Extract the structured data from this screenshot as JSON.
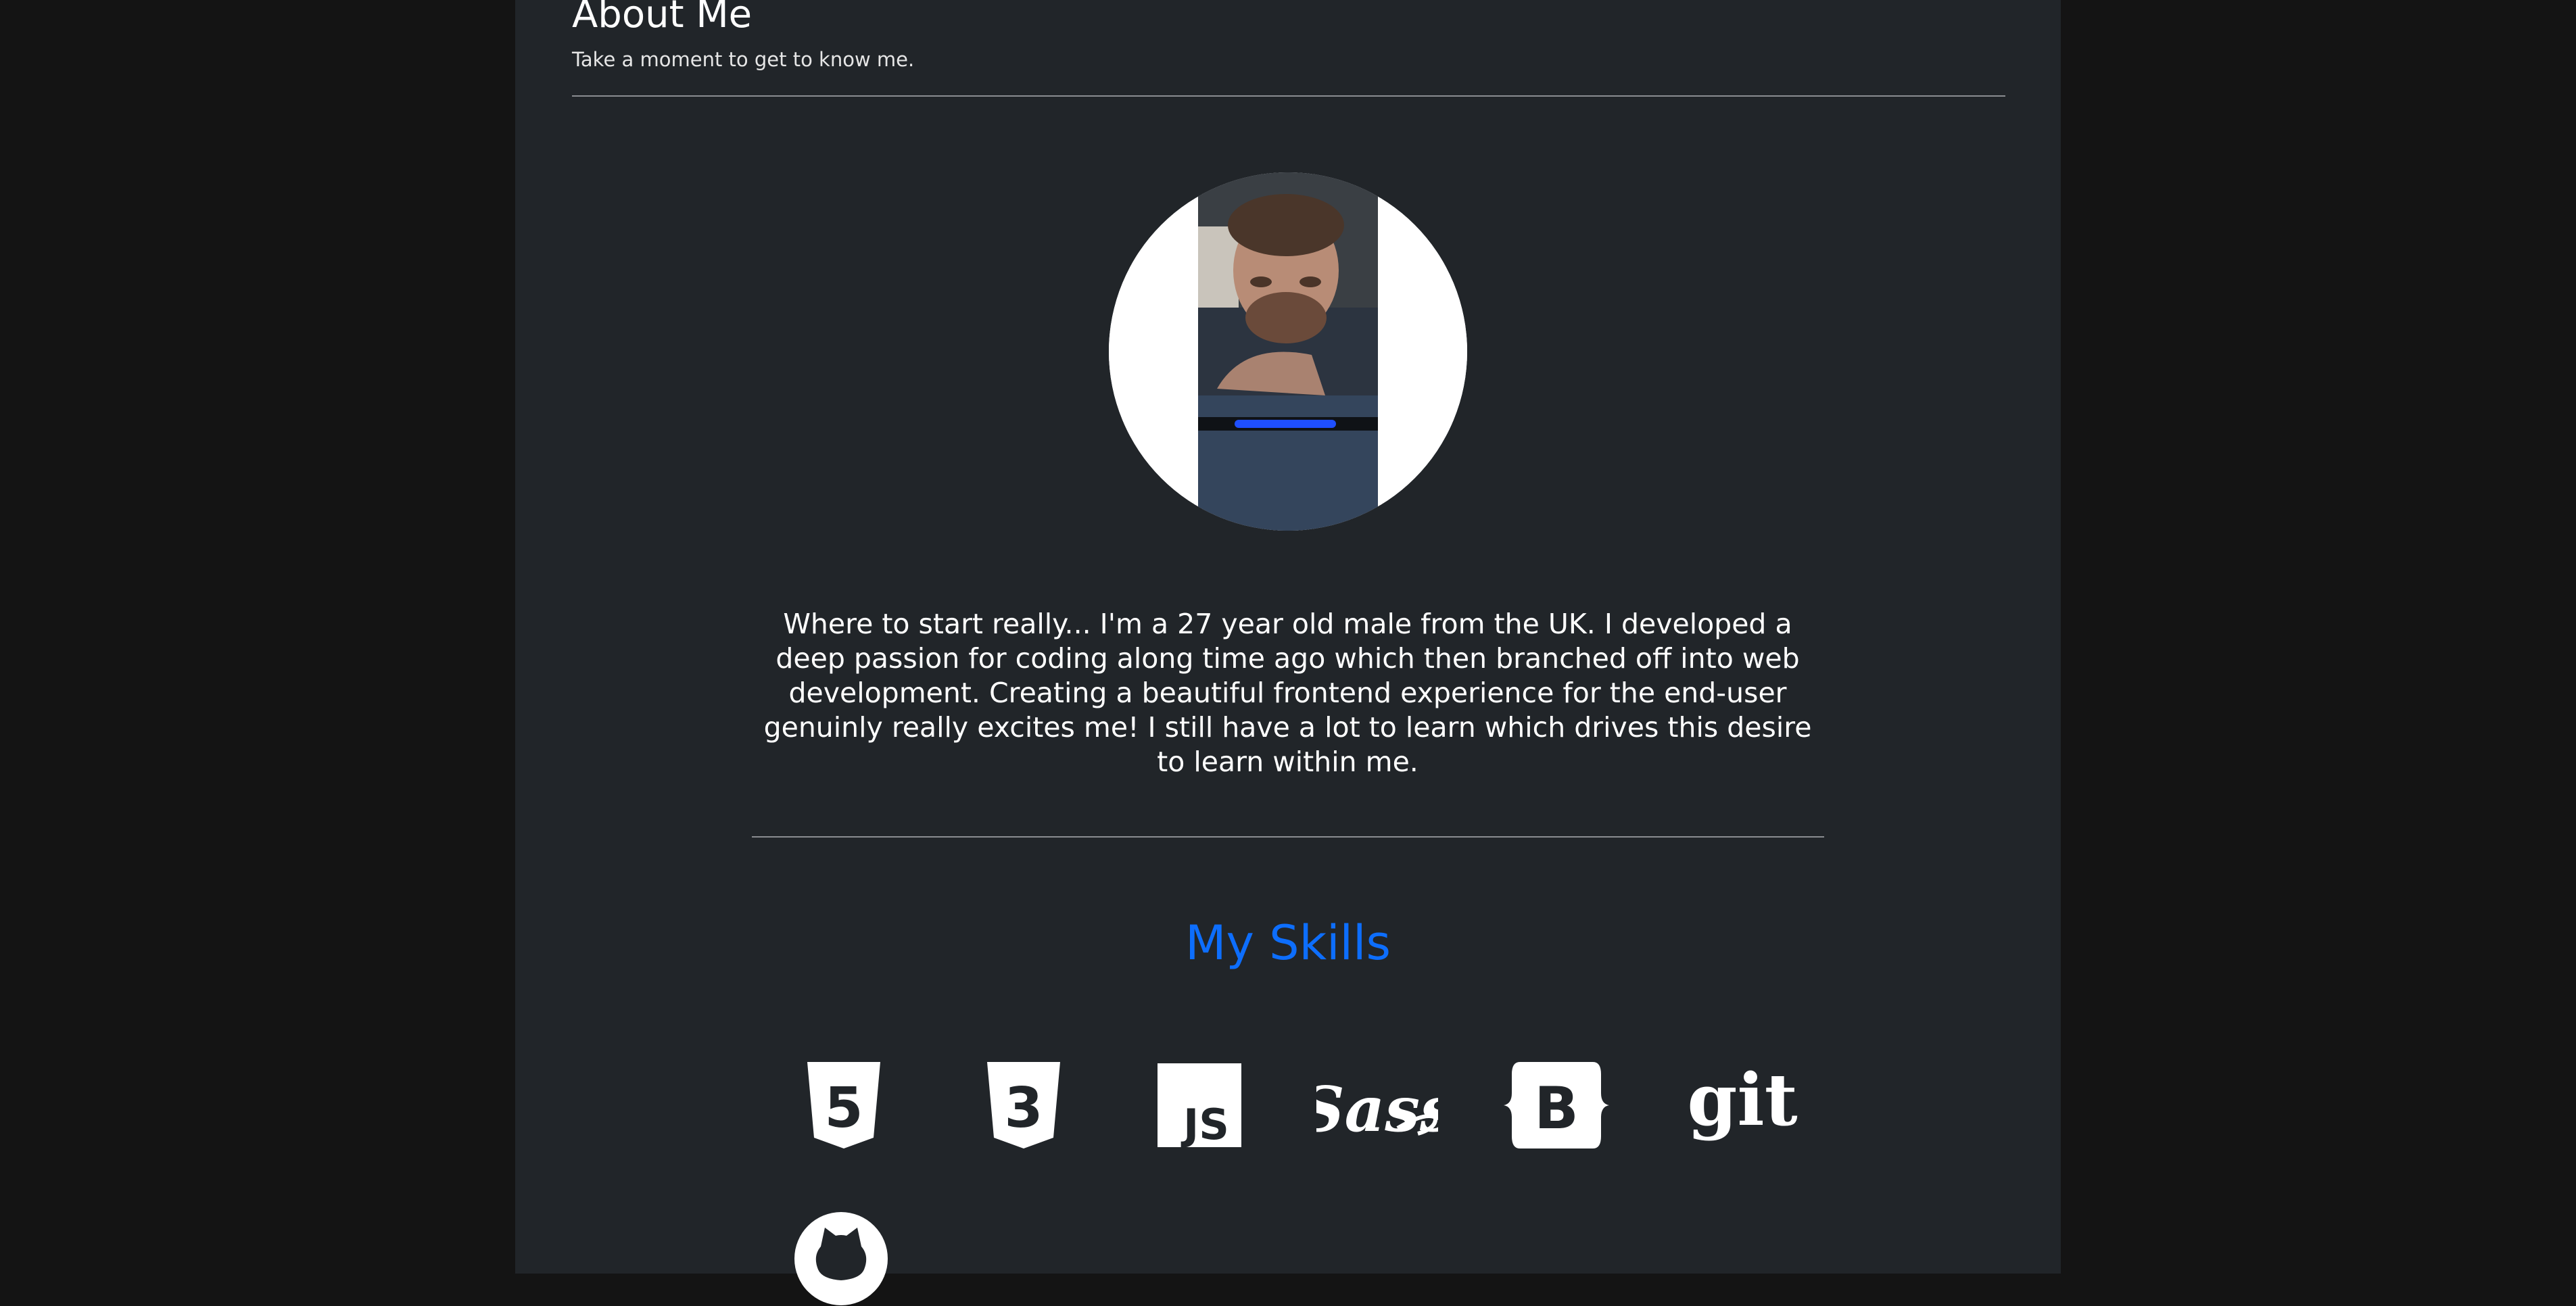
{
  "header": {
    "title": "About Me",
    "subtitle": "Take a moment to get to know me."
  },
  "avatar": {
    "icon": "profile-photo"
  },
  "bio": {
    "text": "Where to start really... I'm a 27 year old male from the UK. I developed a deep passion for coding along time ago which then branched off into web development. Creating a beautiful frontend experience for the end-user genuinly really excites me! I still have a lot to learn which drives this desire to learn within me."
  },
  "skills": {
    "title": "My Skills",
    "accent_color": "#0d6efd",
    "items": [
      {
        "name": "HTML5",
        "icon": "html5-icon",
        "label": "5"
      },
      {
        "name": "CSS3",
        "icon": "css3-icon",
        "label": "3"
      },
      {
        "name": "JavaScript",
        "icon": "javascript-icon",
        "label": "JS"
      },
      {
        "name": "Sass",
        "icon": "sass-icon",
        "label": "Sass"
      },
      {
        "name": "Bootstrap",
        "icon": "bootstrap-icon",
        "label": "B"
      },
      {
        "name": "Git",
        "icon": "git-icon",
        "label": "git"
      },
      {
        "name": "GitHub",
        "icon": "github-icon"
      }
    ]
  },
  "colors": {
    "page_background": "#141414",
    "content_background": "#212529",
    "text": "#ffffff",
    "divider": "#8a8d91"
  }
}
